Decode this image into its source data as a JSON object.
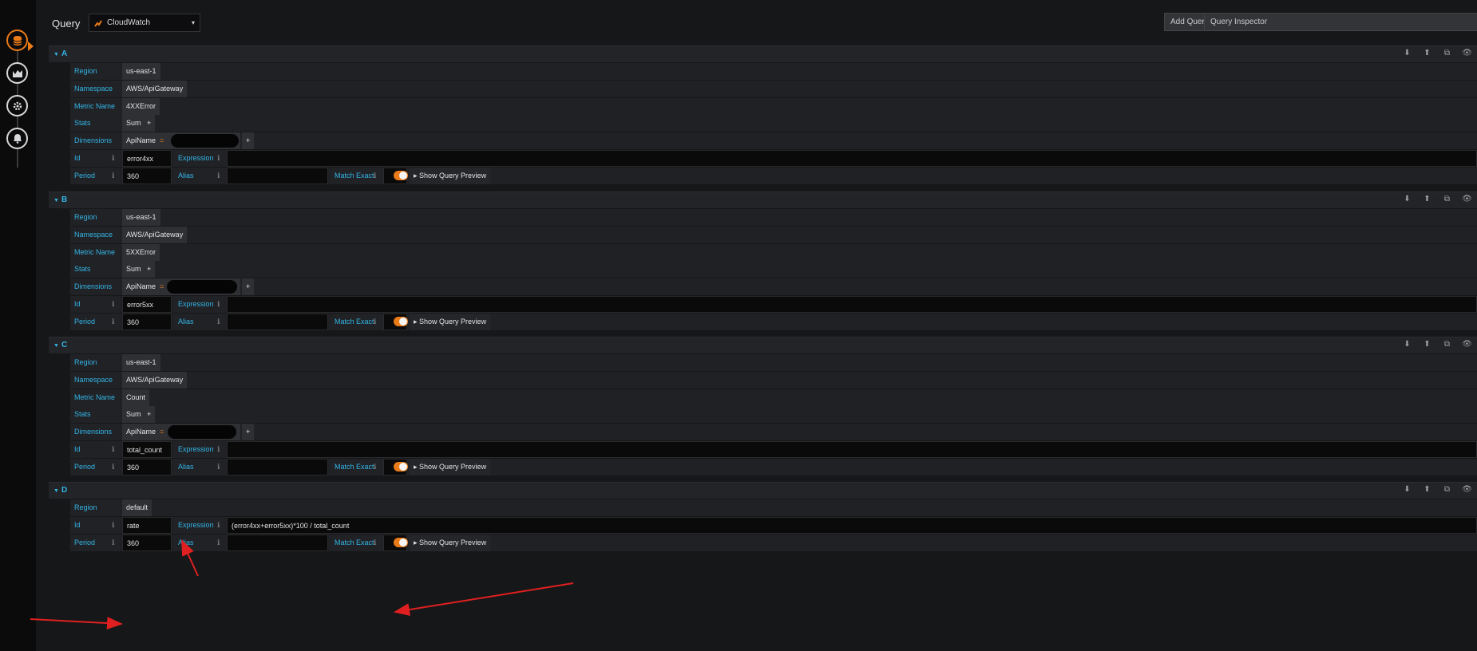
{
  "header": {
    "title": "Query",
    "datasource": "CloudWatch",
    "add_query": "Add Query",
    "query_inspector": "Query Inspector"
  },
  "labels": {
    "region": "Region",
    "namespace": "Namespace",
    "metric_name": "Metric Name",
    "stats": "Stats",
    "dimensions": "Dimensions",
    "id": "Id",
    "expression": "Expression",
    "period": "Period",
    "alias": "Alias",
    "match_exact": "Match Exact",
    "show_query_preview": "Show Query Preview",
    "plus": "+",
    "eq": "="
  },
  "queries": [
    {
      "letter": "A",
      "region": "us-east-1",
      "namespace": "AWS/ApiGateway",
      "metric": "4XXError",
      "stat": "Sum",
      "dim_key": "ApiName",
      "id": "error4xx",
      "expression": "",
      "period": "360",
      "alias": ""
    },
    {
      "letter": "B",
      "region": "us-east-1",
      "namespace": "AWS/ApiGateway",
      "metric": "5XXError",
      "stat": "Sum",
      "dim_key": "ApiName",
      "id": "error5xx",
      "expression": "",
      "period": "360",
      "alias": ""
    },
    {
      "letter": "C",
      "region": "us-east-1",
      "namespace": "AWS/ApiGateway",
      "metric": "Count",
      "stat": "Sum",
      "dim_key": "ApiName",
      "id": "total_count",
      "expression": "",
      "period": "360",
      "alias": ""
    },
    {
      "letter": "D",
      "region": "default",
      "id": "rate",
      "expression": "(error4xx+error5xx)*100 / total_count",
      "period": "360",
      "alias": ""
    }
  ],
  "colors": {
    "accent": "#33b5e5",
    "brand": "#eb7b18",
    "annotation": "#e02020"
  }
}
